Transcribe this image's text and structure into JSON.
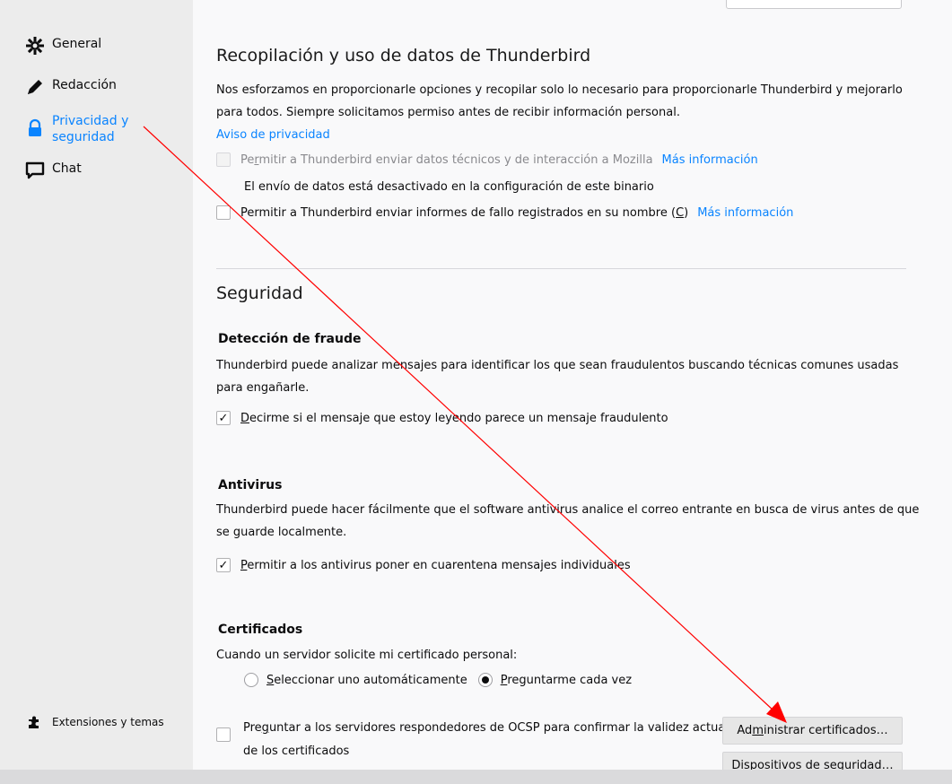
{
  "sidebar": {
    "items": [
      {
        "label": "General",
        "icon": "gear-icon"
      },
      {
        "label": "Redacción",
        "icon": "pencil-icon"
      },
      {
        "label_line1": "Privacidad y",
        "label_line2": "seguridad",
        "icon": "lock-icon",
        "selected": true
      },
      {
        "label": "Chat",
        "icon": "chat-icon"
      }
    ],
    "extensions_label": "Extensiones y temas"
  },
  "data_collection": {
    "title": "Recopilación y uso de datos de Thunderbird",
    "description_line1": "Nos esforzamos en proporcionarle opciones y recopilar solo lo necesario para proporcionarle Thunderbird y mejorarlo",
    "description_line2": "para todos. Siempre solicitamos permiso antes de recibir información personal.",
    "privacy_link": "Aviso de privacidad",
    "telemetry": {
      "label_pre": "Pe",
      "label_key": "r",
      "label_post": "mitir a Thunderbird enviar datos técnicos y de interacción a Mozilla",
      "more": "Más información",
      "checked": false,
      "disabled": true
    },
    "telemetry_note": "El envío de datos está desactivado en la configuración de este binario",
    "crash": {
      "label_pre": "Permitir a Thunderbird enviar informes de fallo registrados en su nombre (",
      "label_key": "C",
      "label_post": ")",
      "more": "Más información",
      "checked": false
    }
  },
  "security": {
    "title": "Seguridad",
    "fraud": {
      "title": "Detección de fraude",
      "description_line1": "Thunderbird puede analizar mensajes para identificar los que sean fraudulentos buscando técnicas comunes usadas",
      "description_line2": "para engañarle.",
      "checkbox_key": "D",
      "checkbox_rest": "ecirme si el mensaje que estoy leyendo parece un mensaje fraudulento",
      "checked": true
    },
    "antivirus": {
      "title": "Antivirus",
      "description_line1": "Thunderbird puede hacer fácilmente que el software antivirus analice el correo entrante en busca de virus antes de que",
      "description_line2": "se guarde localmente.",
      "checkbox_key": "P",
      "checkbox_rest": "ermitir a los antivirus poner en cuarentena mensajes individuales",
      "checked": true
    },
    "certificates": {
      "title": "Certificados",
      "prompt": "Cuando un servidor solicite mi certificado personal:",
      "option_auto_key": "S",
      "option_auto_rest": "eleccionar uno automáticamente",
      "option_ask_key": "P",
      "option_ask_rest": "reguntarme cada vez",
      "selected": "ask",
      "ocsp_pre": "Pre",
      "ocsp_key": "g",
      "ocsp_post": "untar a los servidores respondedores de OCSP para confirmar la validez actual",
      "ocsp_line2": "de los certificados",
      "ocsp_checked": false,
      "manage_pre": "Ad",
      "manage_key": "m",
      "manage_post": "inistrar certificados…",
      "devices_label": "Dispositivos de seguridad…"
    }
  },
  "annotation": {
    "arrow_color": "#ff0000"
  }
}
